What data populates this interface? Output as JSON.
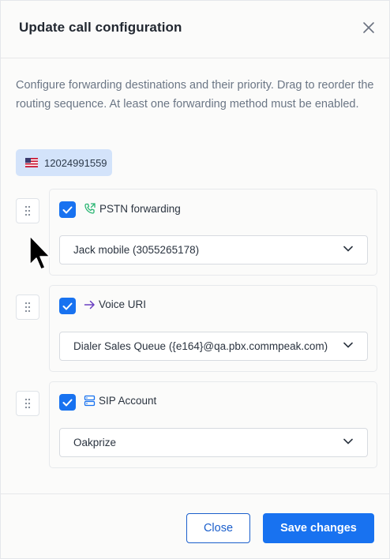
{
  "modal": {
    "title": "Update call configuration",
    "description": "Configure forwarding destinations and their priority. Drag to reorder the routing sequence. At least one forwarding method must be enabled.",
    "phone_number": "12024991559",
    "phone_flag": "us-flag-icon"
  },
  "methods": [
    {
      "label": "PSTN forwarding",
      "icon": "phone-forward-icon",
      "icon_color": "#2bb673",
      "checked": true,
      "selected": "Jack mobile (3055265178)"
    },
    {
      "label": "Voice URI",
      "icon": "arrow-right-icon",
      "icon_color": "#6a3fc1",
      "checked": true,
      "selected": "Dialer Sales Queue ({e164}@qa.pbx.commpeak.com)"
    },
    {
      "label": "SIP Account",
      "icon": "server-icon",
      "icon_color": "#1872f0",
      "checked": true,
      "selected": "Oakprize"
    }
  ],
  "footer": {
    "close_label": "Close",
    "save_label": "Save changes"
  },
  "colors": {
    "accent": "#1872f0",
    "chip_bg": "#d3e3fa"
  }
}
